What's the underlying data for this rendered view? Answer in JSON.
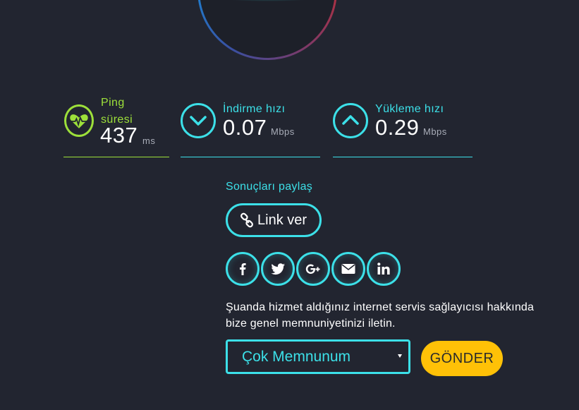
{
  "colors": {
    "background": "#222530",
    "accent_cyan": "#3ce0e8",
    "accent_green": "#9de03a",
    "button_yellow": "#ffc107"
  },
  "stats": {
    "ping": {
      "label": "Ping süresi",
      "value": "437",
      "unit": "ms",
      "icon": "heart-pulse-icon"
    },
    "download": {
      "label": "İndirme hızı",
      "value": "0.07",
      "unit": "Mbps",
      "icon": "chevron-down-icon"
    },
    "upload": {
      "label": "Yükleme hızı",
      "value": "0.29",
      "unit": "Mbps",
      "icon": "chevron-up-icon"
    }
  },
  "share": {
    "title": "Sonuçları paylaş",
    "link_label": "Link ver",
    "socials": [
      "facebook-icon",
      "twitter-icon",
      "google-plus-icon",
      "email-icon",
      "linkedin-icon"
    ]
  },
  "feedback": {
    "text": "Şuanda hizmet aldığınız internet servis sağlayıcısı hakkında bize genel memnuniyetinizi iletin.",
    "selected": "Çok Memnunum",
    "submit_label": "GÖNDER"
  }
}
